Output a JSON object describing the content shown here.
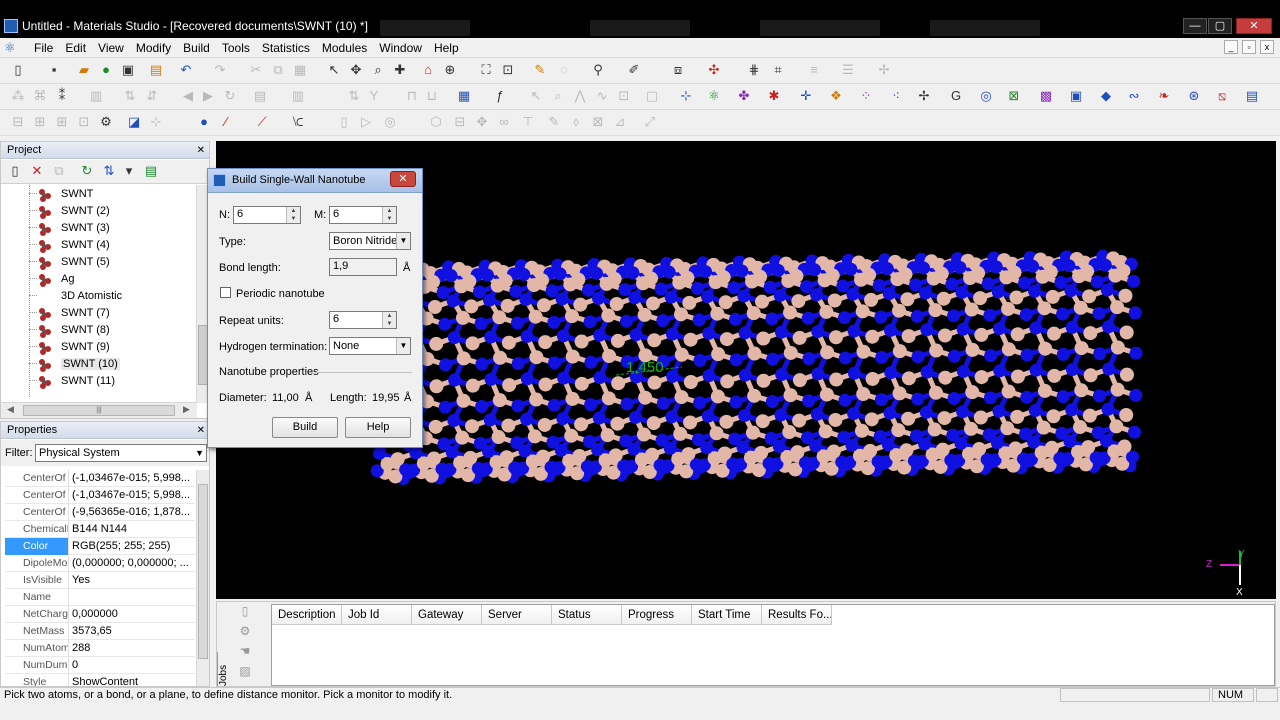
{
  "window": {
    "title": "Untitled - Materials Studio - [Recovered documents\\SWNT (10) *]",
    "min_label": "—",
    "max_label": "▢",
    "close_label": "✕"
  },
  "menubar": {
    "items": [
      "File",
      "Edit",
      "View",
      "Modify",
      "Build",
      "Tools",
      "Statistics",
      "Modules",
      "Window",
      "Help"
    ]
  },
  "project": {
    "header": "Project",
    "items": [
      "SWNT",
      "SWNT (2)",
      "SWNT (3)",
      "SWNT (4)",
      "SWNT (5)",
      "Ag",
      "3D Atomistic",
      "SWNT (7)",
      "SWNT (8)",
      "SWNT (9)",
      "SWNT (10)",
      "SWNT (11)"
    ],
    "selected_index": 10
  },
  "properties": {
    "header": "Properties",
    "filter_label": "Filter:",
    "filter_value": "Physical System",
    "rows": [
      {
        "name": "CenterOf",
        "value": "(-1,03467e-015; 5,998..."
      },
      {
        "name": "CenterOf",
        "value": "(-1,03467e-015; 5,998..."
      },
      {
        "name": "CenterOf",
        "value": "(-9,56365e-016; 1,878..."
      },
      {
        "name": "ChemicalF",
        "value": "B144 N144"
      },
      {
        "name": "Color",
        "value": "RGB(255; 255; 255)"
      },
      {
        "name": "DipoleMor",
        "value": "(0,000000; 0,000000; ..."
      },
      {
        "name": "IsVisible",
        "value": "Yes"
      },
      {
        "name": "Name",
        "value": ""
      },
      {
        "name": "NetCharg",
        "value": "0,000000"
      },
      {
        "name": "NetMass",
        "value": "3573,65"
      },
      {
        "name": "NumAtom",
        "value": "288"
      },
      {
        "name": "NumDumm",
        "value": "0"
      },
      {
        "name": "Style",
        "value": "ShowContent"
      }
    ],
    "selected_index": 4
  },
  "dialog": {
    "title": "Build Single-Wall Nanotube",
    "close_label": "✕",
    "n_label": "N:",
    "n_value": "6",
    "m_label": "M:",
    "m_value": "6",
    "type_label": "Type:",
    "type_value": "Boron Nitride",
    "bond_label": "Bond length:",
    "bond_value": "1,9",
    "bond_unit": "Å",
    "periodic_label": "Periodic nanotube",
    "repeat_label": "Repeat units:",
    "repeat_value": "6",
    "hydrogen_label": "Hydrogen termination:",
    "hydrogen_value": "None",
    "props_label": "Nanotube properties",
    "diameter_label": "Diameter:",
    "diameter_value": "11,00",
    "diameter_unit": "Å",
    "length_label": "Length:",
    "length_value": "19,95",
    "length_unit": "Å",
    "build_label": "Build",
    "help_label": "Help"
  },
  "viewport": {
    "distance_label": "1,450",
    "axis_z": "Z",
    "axis_y": "Y",
    "axis_x": "X",
    "colors": {
      "boron": "#e3b7a8",
      "nitrogen": "#1010e0",
      "background": "#000000",
      "monitor": "#10b010"
    }
  },
  "jobs": {
    "tab_label": "Jobs",
    "columns": [
      "Description",
      "Job Id",
      "Gateway",
      "Server",
      "Status",
      "Progress",
      "Start Time",
      "Results Fo..."
    ]
  },
  "statusbar": {
    "message": "Pick two atoms, or a bond, or a plane, to define distance monitor. Pick a monitor to modify it.",
    "num": "NUM"
  }
}
